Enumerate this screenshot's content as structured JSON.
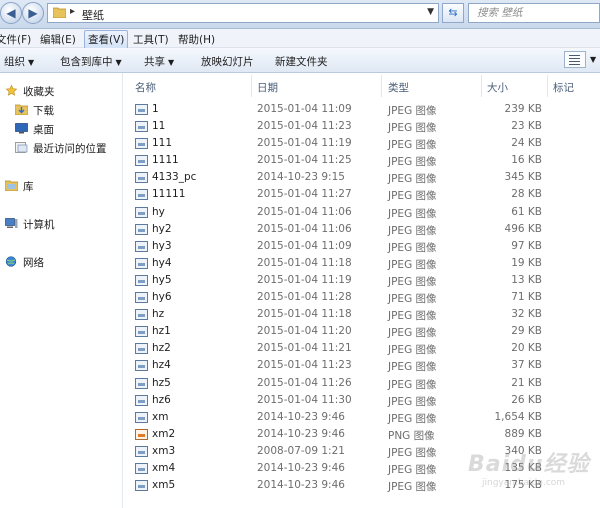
{
  "address_bar": {
    "path": "壁纸",
    "search_placeholder": "搜索 壁纸"
  },
  "menu": [
    "文件(F)",
    "编辑(E)",
    "查看(V)",
    "工具(T)",
    "帮助(H)"
  ],
  "commands": {
    "organize": "组织",
    "include": "包含到库中",
    "share": "共享",
    "slideshow": "放映幻灯片",
    "new_folder": "新建文件夹"
  },
  "nav": {
    "favorites": "收藏夹",
    "downloads": "下载",
    "desktop": "桌面",
    "recent": "最近访问的位置",
    "libraries": "库",
    "computer": "计算机",
    "network": "网络"
  },
  "columns": {
    "name": "名称",
    "date": "日期",
    "type": "类型",
    "size": "大小",
    "tags": "标记"
  },
  "files": [
    {
      "name": "1",
      "date": "2015-01-04 11:09",
      "type": "JPEG 图像",
      "size": "239 KB"
    },
    {
      "name": "11",
      "date": "2015-01-04 11:23",
      "type": "JPEG 图像",
      "size": "23 KB"
    },
    {
      "name": "111",
      "date": "2015-01-04 11:19",
      "type": "JPEG 图像",
      "size": "24 KB"
    },
    {
      "name": "1111",
      "date": "2015-01-04 11:25",
      "type": "JPEG 图像",
      "size": "16 KB"
    },
    {
      "name": "4133_pc",
      "date": "2014-10-23 9:15",
      "type": "JPEG 图像",
      "size": "345 KB"
    },
    {
      "name": "11111",
      "date": "2015-01-04 11:27",
      "type": "JPEG 图像",
      "size": "28 KB"
    },
    {
      "name": "hy",
      "date": "2015-01-04 11:06",
      "type": "JPEG 图像",
      "size": "61 KB"
    },
    {
      "name": "hy2",
      "date": "2015-01-04 11:06",
      "type": "JPEG 图像",
      "size": "496 KB"
    },
    {
      "name": "hy3",
      "date": "2015-01-04 11:09",
      "type": "JPEG 图像",
      "size": "97 KB"
    },
    {
      "name": "hy4",
      "date": "2015-01-04 11:18",
      "type": "JPEG 图像",
      "size": "19 KB"
    },
    {
      "name": "hy5",
      "date": "2015-01-04 11:19",
      "type": "JPEG 图像",
      "size": "13 KB"
    },
    {
      "name": "hy6",
      "date": "2015-01-04 11:28",
      "type": "JPEG 图像",
      "size": "71 KB"
    },
    {
      "name": "hz",
      "date": "2015-01-04 11:18",
      "type": "JPEG 图像",
      "size": "32 KB"
    },
    {
      "name": "hz1",
      "date": "2015-01-04 11:20",
      "type": "JPEG 图像",
      "size": "29 KB"
    },
    {
      "name": "hz2",
      "date": "2015-01-04 11:21",
      "type": "JPEG 图像",
      "size": "20 KB"
    },
    {
      "name": "hz4",
      "date": "2015-01-04 11:23",
      "type": "JPEG 图像",
      "size": "37 KB"
    },
    {
      "name": "hz5",
      "date": "2015-01-04 11:26",
      "type": "JPEG 图像",
      "size": "21 KB"
    },
    {
      "name": "hz6",
      "date": "2015-01-04 11:30",
      "type": "JPEG 图像",
      "size": "26 KB"
    },
    {
      "name": "xm",
      "date": "2014-10-23 9:46",
      "type": "JPEG 图像",
      "size": "1,654 KB"
    },
    {
      "name": "xm2",
      "date": "2014-10-23 9:46",
      "type": "PNG 图像",
      "size": "889 KB"
    },
    {
      "name": "xm3",
      "date": "2008-07-09 1:21",
      "type": "JPEG 图像",
      "size": "340 KB"
    },
    {
      "name": "xm4",
      "date": "2014-10-23 9:46",
      "type": "JPEG 图像",
      "size": "135 KB"
    },
    {
      "name": "xm5",
      "date": "2014-10-23 9:46",
      "type": "JPEG 图像",
      "size": "175 KB"
    }
  ],
  "watermark": "Baidu经验",
  "watermark_sub": "jingyan.baidu.com"
}
